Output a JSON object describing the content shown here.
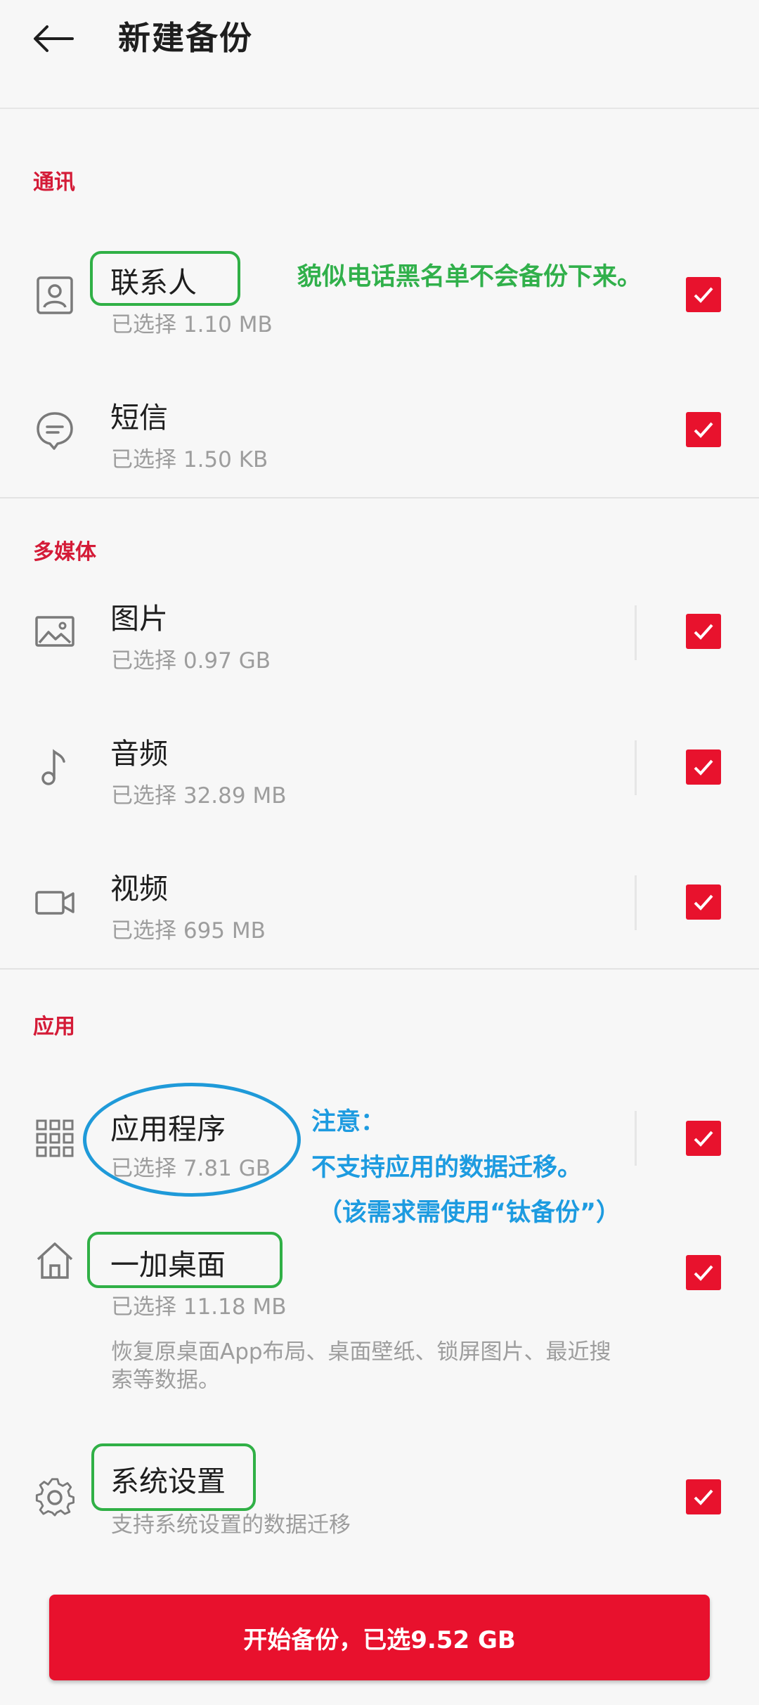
{
  "header": {
    "title": "新建备份",
    "back_icon": "arrow-left-icon"
  },
  "sections": [
    {
      "title": "通讯",
      "items": [
        {
          "label": "联系人",
          "sub": "已选择 1.10 MB",
          "icon": "contact-card-icon",
          "checked": true
        },
        {
          "label": "短信",
          "sub": "已选择 1.50 KB",
          "icon": "message-bubble-icon",
          "checked": true
        }
      ]
    },
    {
      "title": "多媒体",
      "items": [
        {
          "label": "图片",
          "sub": "已选择 0.97 GB",
          "icon": "image-icon",
          "checked": true
        },
        {
          "label": "音频",
          "sub": "已选择 32.89 MB",
          "icon": "music-note-icon",
          "checked": true
        },
        {
          "label": "视频",
          "sub": "已选择 695 MB",
          "icon": "video-camera-icon",
          "checked": true
        }
      ]
    },
    {
      "title": "应用",
      "items": [
        {
          "label": "应用程序",
          "sub": "已选择 7.81 GB",
          "icon": "app-grid-icon",
          "checked": true
        },
        {
          "label": "一加桌面",
          "sub": "已选择 11.18 MB",
          "desc": "恢复原桌面App布局、桌面壁纸、锁屏图片、最近搜索等数据。",
          "icon": "home-icon",
          "checked": true
        },
        {
          "label": "系统设置",
          "sub": "支持系统设置的数据迁移",
          "icon": "gear-icon",
          "checked": true
        }
      ]
    }
  ],
  "annotations": {
    "contacts_note": "貌似电话黑名单不会备份下来。",
    "apps_note_title": "注意：",
    "apps_note_line1": "不支持应用的数据迁移。",
    "apps_note_line2": "（该需求需使用“钛备份”）"
  },
  "footer": {
    "button_label": "开始备份，已选9.52 GB"
  },
  "colors": {
    "accent": "#e8122d",
    "section_title": "#d41b37",
    "annotation_green": "#31b04b",
    "annotation_blue": "#1d9be0"
  }
}
